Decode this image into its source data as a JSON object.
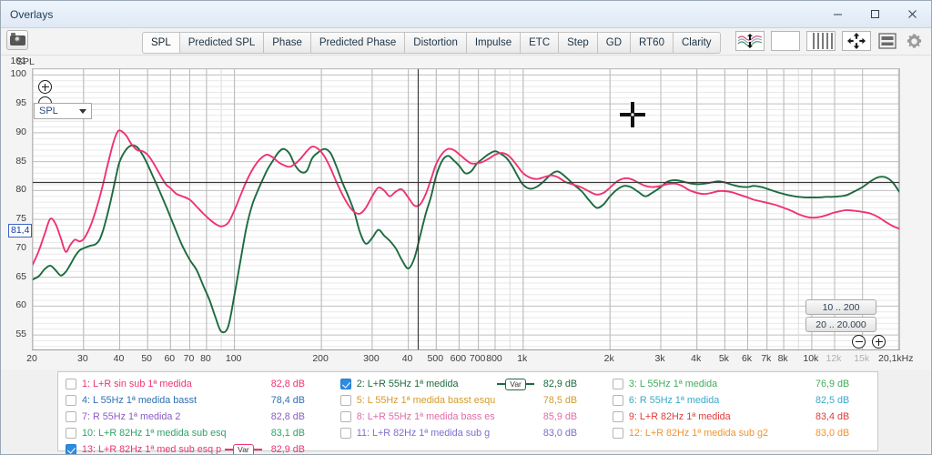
{
  "window": {
    "title": "Overlays",
    "minimize": "–",
    "maximize": "☐",
    "close": "✕"
  },
  "toolbar": {
    "camera_icon": "camera-icon",
    "tabs": [
      {
        "label": "SPL",
        "active": true
      },
      {
        "label": "Predicted SPL",
        "active": false
      },
      {
        "label": "Phase",
        "active": false
      },
      {
        "label": "Predicted Phase",
        "active": false
      },
      {
        "label": "Distortion",
        "active": false
      },
      {
        "label": "Impulse",
        "active": false
      },
      {
        "label": "ETC",
        "active": false
      },
      {
        "label": "Step",
        "active": false
      },
      {
        "label": "GD",
        "active": false
      },
      {
        "label": "RT60",
        "active": false
      },
      {
        "label": "Clarity",
        "active": false
      }
    ],
    "right_tools": [
      {
        "name": "waveform-traces-icon"
      },
      {
        "name": "blank-page-icon"
      },
      {
        "name": "bars-columns-icon"
      },
      {
        "name": "move-arrows-icon"
      },
      {
        "name": "layout-panels-icon"
      },
      {
        "name": "gear-icon"
      }
    ]
  },
  "chart_controls": {
    "y_axis_title": "SPL",
    "zoom_in": "+",
    "zoom_out": "−",
    "measurement_select": "SPL",
    "range_preset_1": "10 .. 200",
    "range_preset_2": "20 .. 20.000",
    "cursor_y_value": "81,4",
    "cursor_x_value": "433"
  },
  "chart_data": {
    "type": "line",
    "title": "SPL",
    "xlabel": "",
    "ylabel": "SPL",
    "xscale": "log",
    "xlim": [
      20,
      20100
    ],
    "ylim": [
      52.5,
      101
    ],
    "grid": true,
    "legend_position": "bottom",
    "y_ticks": [
      100,
      95,
      90,
      85,
      80,
      75,
      70,
      65,
      60,
      55
    ],
    "y_tick_top_label": "101",
    "x_ticks": [
      {
        "value": 20,
        "label": "20"
      },
      {
        "value": 30,
        "label": "30"
      },
      {
        "value": 40,
        "label": "40"
      },
      {
        "value": 50,
        "label": "50"
      },
      {
        "value": 60,
        "label": "60"
      },
      {
        "value": 70,
        "label": "70"
      },
      {
        "value": 80,
        "label": "80"
      },
      {
        "value": 100,
        "label": "100"
      },
      {
        "value": 200,
        "label": "200"
      },
      {
        "value": 300,
        "label": "300"
      },
      {
        "value": 400,
        "label": "40"
      },
      {
        "value": 500,
        "label": "500"
      },
      {
        "value": 600,
        "label": "600"
      },
      {
        "value": 700,
        "label": "700"
      },
      {
        "value": 800,
        "label": "800"
      },
      {
        "value": 1000,
        "label": "1k"
      },
      {
        "value": 2000,
        "label": "2k"
      },
      {
        "value": 3000,
        "label": "3k"
      },
      {
        "value": 4000,
        "label": "4k"
      },
      {
        "value": 5000,
        "label": "5k"
      },
      {
        "value": 6000,
        "label": "6k"
      },
      {
        "value": 7000,
        "label": "7k"
      },
      {
        "value": 8000,
        "label": "8k"
      },
      {
        "value": 10000,
        "label": "10k"
      },
      {
        "value": 12000,
        "label": "12k",
        "dim": true
      },
      {
        "value": 15000,
        "label": "15k",
        "dim": true
      },
      {
        "value": 20100,
        "label": "20,1kHz"
      }
    ],
    "cursor_line_x": 433,
    "cursor_line_y": 81.4,
    "series": [
      {
        "name": "2: L+R 55Hz 1ª medida",
        "color": "#1d6b3f",
        "x": [
          20,
          21,
          22,
          23,
          24,
          25,
          26,
          27,
          28,
          29,
          30,
          31,
          32,
          33,
          34,
          35,
          36,
          37,
          38,
          39,
          40,
          42,
          44,
          46,
          48,
          50,
          52,
          54,
          56,
          58,
          60,
          63,
          66,
          70,
          74,
          78,
          82,
          86,
          90,
          95,
          100,
          105,
          110,
          115,
          120,
          125,
          130,
          136,
          142,
          148,
          155,
          162,
          170,
          178,
          186,
          195,
          205,
          215,
          225,
          236,
          248,
          260,
          272,
          285,
          300,
          315,
          330,
          345,
          362,
          380,
          400,
          420,
          440,
          460,
          480,
          500,
          525,
          550,
          575,
          600,
          630,
          660,
          690,
          720,
          760,
          800,
          840,
          880,
          920,
          960,
          1000,
          1060,
          1120,
          1180,
          1250,
          1320,
          1400,
          1500,
          1600,
          1700,
          1800,
          1900,
          2000,
          2120,
          2240,
          2360,
          2500,
          2650,
          2800,
          3000,
          3150,
          3350,
          3550,
          3750,
          4000,
          4250,
          4500,
          4750,
          5000,
          5300,
          5600,
          6000,
          6300,
          6700,
          7100,
          7500,
          8000,
          8500,
          9000,
          9500,
          10000,
          10600,
          11200,
          11800,
          12500,
          13200,
          14000,
          15000,
          16000,
          17000,
          18000,
          19000,
          20100
        ],
        "y": [
          64.6,
          65.2,
          66.4,
          67.0,
          66.2,
          65.3,
          65.9,
          67.2,
          68.6,
          69.6,
          70.0,
          70.3,
          70.5,
          70.7,
          71.4,
          73.0,
          75.2,
          77.6,
          80.2,
          82.8,
          85.0,
          87.0,
          87.8,
          87.5,
          86.2,
          84.5,
          82.6,
          80.8,
          79.0,
          77.2,
          75.4,
          72.8,
          70.4,
          68.0,
          66.2,
          63.5,
          61.0,
          58.0,
          55.6,
          56.4,
          62.0,
          68.0,
          73.6,
          77.4,
          79.8,
          81.8,
          83.6,
          85.2,
          86.6,
          87.2,
          86.4,
          84.4,
          83.2,
          83.4,
          85.6,
          86.6,
          87.2,
          86.5,
          84.3,
          81.5,
          79.0,
          76.3,
          72.8,
          70.8,
          71.8,
          73.2,
          72.2,
          71.3,
          70.0,
          68.0,
          66.5,
          68.3,
          72.2,
          76.0,
          79.0,
          82.6,
          85.2,
          86.0,
          85.2,
          84.3,
          83.0,
          83.3,
          84.6,
          85.4,
          86.3,
          86.8,
          86.3,
          85.5,
          84.1,
          82.4,
          81.0,
          80.3,
          80.7,
          81.6,
          82.8,
          83.3,
          82.4,
          81.0,
          79.8,
          78.2,
          77.0,
          77.6,
          79.0,
          80.2,
          80.8,
          80.6,
          79.8,
          79.0,
          79.6,
          80.6,
          81.5,
          81.8,
          81.6,
          81.3,
          81.1,
          81.2,
          81.4,
          81.6,
          81.4,
          81.0,
          80.7,
          80.6,
          80.8,
          80.6,
          80.2,
          79.8,
          79.4,
          79.1,
          78.9,
          78.8,
          78.8,
          78.8,
          78.9,
          78.9,
          79.0,
          79.2,
          79.8,
          80.6,
          81.6,
          82.3,
          82.3,
          81.5,
          79.8,
          77.6,
          76.0,
          75.3,
          75.2,
          75.4,
          74.6,
          73.6,
          73.4
        ]
      },
      {
        "name": "13: L+R 82Hz 1ª med sub esq p",
        "color": "#ef3372",
        "x": [
          20,
          21,
          22,
          23,
          24,
          25,
          26,
          27,
          28,
          29,
          30,
          31,
          32,
          33,
          34,
          35,
          36,
          37,
          38,
          39,
          40,
          42,
          44,
          46,
          48,
          50,
          52,
          54,
          56,
          58,
          60,
          63,
          66,
          70,
          74,
          78,
          82,
          86,
          90,
          95,
          100,
          105,
          110,
          115,
          120,
          125,
          130,
          136,
          142,
          148,
          155,
          162,
          170,
          178,
          186,
          195,
          205,
          215,
          225,
          236,
          248,
          260,
          272,
          285,
          300,
          315,
          330,
          345,
          362,
          380,
          400,
          420,
          440,
          460,
          480,
          500,
          525,
          550,
          575,
          600,
          630,
          660,
          690,
          720,
          760,
          800,
          840,
          880,
          920,
          960,
          1000,
          1060,
          1120,
          1180,
          1250,
          1320,
          1400,
          1500,
          1600,
          1700,
          1800,
          1900,
          2000,
          2120,
          2240,
          2360,
          2500,
          2650,
          2800,
          3000,
          3150,
          3350,
          3550,
          3750,
          4000,
          4250,
          4500,
          4750,
          5000,
          5300,
          5600,
          6000,
          6300,
          6700,
          7100,
          7500,
          8000,
          8500,
          9000,
          9500,
          10000,
          10600,
          11200,
          11800,
          12500,
          13200,
          14000,
          15000,
          16000,
          17000,
          18000,
          19000,
          20100
        ],
        "y": [
          67.2,
          69.6,
          72.5,
          75.1,
          74.2,
          71.8,
          69.4,
          70.6,
          71.5,
          71.2,
          71.6,
          72.8,
          74.4,
          76.4,
          78.6,
          81.0,
          83.6,
          86.0,
          88.2,
          89.8,
          90.4,
          89.6,
          88.0,
          87.0,
          86.8,
          86.2,
          85.0,
          83.6,
          82.2,
          81.0,
          80.4,
          79.4,
          79.0,
          78.4,
          77.2,
          76.0,
          75.0,
          74.2,
          73.8,
          74.4,
          76.6,
          79.2,
          81.6,
          83.5,
          84.9,
          85.8,
          86.2,
          85.7,
          84.9,
          84.4,
          84.1,
          84.6,
          85.6,
          86.8,
          87.6,
          87.2,
          85.9,
          83.9,
          81.6,
          79.4,
          77.5,
          76.3,
          76.0,
          77.0,
          79.0,
          80.5,
          80.0,
          79.0,
          79.8,
          80.2,
          78.8,
          77.4,
          77.6,
          79.4,
          82.0,
          84.6,
          86.4,
          87.2,
          87.0,
          86.3,
          85.4,
          84.7,
          84.7,
          84.9,
          85.5,
          86.2,
          86.5,
          86.2,
          85.3,
          84.1,
          83.0,
          82.2,
          82.0,
          82.3,
          82.6,
          82.3,
          81.5,
          81.0,
          80.5,
          79.8,
          79.3,
          79.6,
          80.5,
          81.6,
          82.1,
          82.0,
          81.4,
          80.8,
          80.6,
          80.8,
          81.1,
          81.2,
          80.8,
          80.1,
          79.6,
          79.4,
          79.6,
          79.9,
          79.9,
          79.7,
          79.3,
          78.8,
          78.4,
          78.1,
          77.8,
          77.5,
          77.0,
          76.5,
          75.9,
          75.5,
          75.3,
          75.4,
          75.7,
          76.1,
          76.4,
          76.6,
          76.5,
          76.3,
          76.0,
          75.4,
          74.6,
          73.9,
          73.4,
          73.0,
          72.8,
          72.6,
          72.3,
          71.8,
          71.2
        ]
      }
    ]
  },
  "legend": {
    "columns": [
      {
        "rows": [
          {
            "checked": false,
            "label": "1: L+R sin sub 1ª medida",
            "value": "82,8 dB",
            "color": "#ef3372",
            "badge": null
          },
          {
            "checked": false,
            "label": "4: L 55Hz 1ª medida basst",
            "value": "78,4 dB",
            "color": "#2f6fb0",
            "badge": null
          },
          {
            "checked": false,
            "label": "7: R 55Hz 1ª medida 2",
            "value": "82,8 dB",
            "color": "#8b5cc7",
            "badge": null
          },
          {
            "checked": false,
            "label": "10: L+R 82Hz 1ª medida sub esq",
            "value": "83,1 dB",
            "color": "#2ea36a",
            "badge": null
          },
          {
            "checked": true,
            "label": "13: L+R 82Hz 1ª med sub esq p",
            "value": "82,9 dB",
            "color": "#ef3372",
            "badge": "Var"
          }
        ]
      },
      {
        "rows": [
          {
            "checked": true,
            "label": "2: L+R 55Hz 1ª medida",
            "value": "82,9 dB",
            "color": "#1d6b3f",
            "badge": "Var"
          },
          {
            "checked": false,
            "label": "5: L 55Hz 1ª medida basst esqu",
            "value": "78,5 dB",
            "color": "#d49a2a",
            "badge": null
          },
          {
            "checked": false,
            "label": "8: L+R 55Hz 1ª medida bass es",
            "value": "85,9 dB",
            "color": "#e26ba8",
            "badge": null
          },
          {
            "checked": false,
            "label": "11: L+R 82Hz 1ª medida sub g",
            "value": "83,0 dB",
            "color": "#7b6fd0",
            "badge": null
          }
        ]
      },
      {
        "rows": [
          {
            "checked": false,
            "label": "3: L 55Hz 1ª medida",
            "value": "76,9 dB",
            "color": "#3fae5a",
            "badge": null
          },
          {
            "checked": false,
            "label": "6: R 55Hz 1ª medida",
            "value": "82,5 dB",
            "color": "#3aa8c8",
            "badge": null
          },
          {
            "checked": false,
            "label": "9: L+R 82Hz 1ª medida",
            "value": "83,4 dB",
            "color": "#e03a3a",
            "badge": null
          },
          {
            "checked": false,
            "label": "12: L+R 82Hz 1ª medida sub g2",
            "value": "83,0 dB",
            "color": "#f0952e",
            "badge": null
          }
        ]
      }
    ]
  }
}
